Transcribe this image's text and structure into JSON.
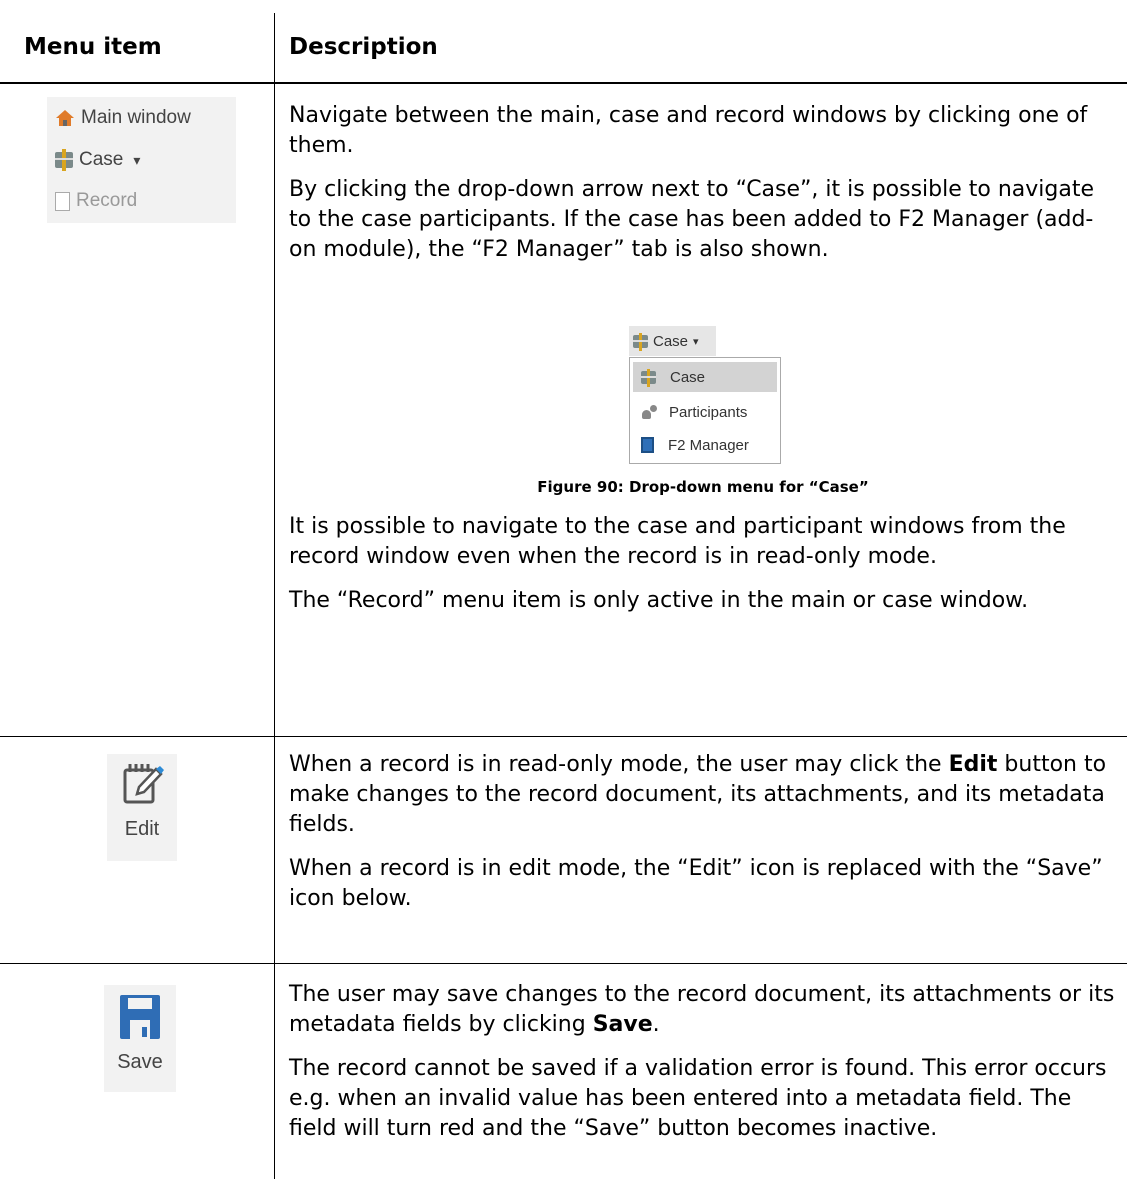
{
  "header": {
    "col1": "Menu item",
    "col2": "Description"
  },
  "nav_menu": {
    "items": [
      {
        "label": "Main window",
        "icon": "home-icon",
        "enabled": true
      },
      {
        "label": "Case",
        "icon": "case-icon",
        "enabled": true,
        "dropdown": "▾"
      },
      {
        "label": "Record",
        "icon": "record-icon",
        "enabled": false
      }
    ]
  },
  "row1": {
    "p1": "Navigate between the main, case and record windows by clicking one of them.",
    "p2": "By clicking the drop-down arrow next to “Case”, it is possible to navigate to the case participants. If the case has been added to F2 Manager (add-on module), the “F2 Manager” tab is also shown.",
    "figure": {
      "button_label": "Case",
      "button_arrow": "▾",
      "items": [
        "Case",
        "Participants",
        "F2 Manager"
      ],
      "caption": "Figure 90: Drop-down menu for “Case”"
    },
    "p3": "It is possible to navigate to the case and participant windows from the record window even when the record is in read-only mode.",
    "p4": "The “Record” menu item is only active in the main or case window."
  },
  "row2": {
    "button_label": "Edit",
    "p1_a": "When a record is in read-only mode, the user may click the ",
    "p1_bold": "Edit",
    "p1_b": " button to make changes to the record document, its attachments, and its metadata fields.",
    "p2": "When a record is in edit mode, the “Edit” icon is replaced with the “Save” icon below."
  },
  "row3": {
    "button_label": "Save",
    "p1_a": "The user may save changes to the record document, its attachments or its metadata fields by clicking ",
    "p1_bold": "Save",
    "p1_b": ".",
    "p2": "The record cannot be saved if a validation error is found. This error occurs e.g. when an invalid value has been entered into a metadata field. The field will turn red and the “Save” button becomes inactive."
  },
  "colors": {
    "save_blue": "#2f6db5",
    "border": "#000000",
    "panel_bg": "#f2f2f2"
  }
}
